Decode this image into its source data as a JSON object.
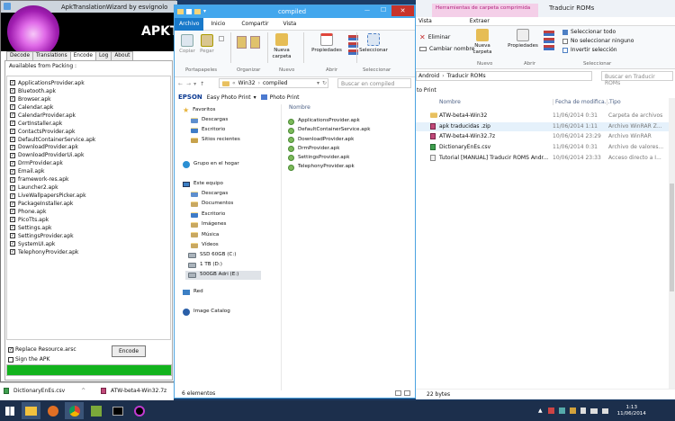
{
  "desktop": {
    "bg": "#1b3c67"
  },
  "apk_wizard": {
    "title": "ApkTranslationWizard by esvignolo",
    "logo_text": "APKT",
    "tabs": [
      "Decode",
      "Translations",
      "Encode",
      "Log",
      "About"
    ],
    "available_label": "Availables from Packing :",
    "files": [
      "ApplicationsProvider.apk",
      "Bluetooth.apk",
      "Browser.apk",
      "Calendar.apk",
      "CalendarProvider.apk",
      "CertInstaller.apk",
      "ContactsProvider.apk",
      "DefaultContainerService.apk",
      "DownloadProvider.apk",
      "DownloadProviderUi.apk",
      "DrmProvider.apk",
      "Email.apk",
      "framework-res.apk",
      "Launcher2.apk",
      "LiveWallpapersPicker.apk",
      "PackageInstaller.apk",
      "Phone.apk",
      "PicoTts.apk",
      "Settings.apk",
      "SettingsProvider.apk",
      "SystemUI.apk",
      "TelephonyProvider.apk"
    ],
    "check_mark": "✓",
    "replace_label": "Replace Resource.arsc",
    "sign_label": "Sign the APK",
    "encode_button": "Encode"
  },
  "explorer": {
    "title": "compiled",
    "quick_access": "▾",
    "min": "—",
    "max": "☐",
    "close": "✕",
    "ribbon_tabs": [
      "Archivo",
      "Inicio",
      "Compartir",
      "Vista"
    ],
    "groups": [
      "Portapapeles",
      "Organizar",
      "Nuevo",
      "Abrir",
      "Seleccionar"
    ],
    "btn_copiar": "Copiar",
    "btn_pegar": "Pegar",
    "btn_nueva": "Nueva carpeta",
    "btn_propiedades": "Propiedades",
    "btn_seleccionar": "Seleccionar",
    "nav_back": "←",
    "nav_fwd": "→",
    "nav_up": "↑",
    "path_prefix": "«",
    "path": [
      "Win32",
      "compiled"
    ],
    "path_sep": "›",
    "dropdown": "▾",
    "refresh": "↻",
    "search_placeholder": "Buscar en compiled",
    "epson": "EPSON",
    "epson_app": "Easy Photo Print",
    "epson_sep": "▾",
    "photo_print": "Photo Print",
    "nav_tree": {
      "favorites": "Favoritos",
      "fav_items": [
        "Descargas",
        "Escritorio",
        "Sitios recientes"
      ],
      "homegroup": "Grupo en el hogar",
      "this_pc": "Este equipo",
      "pc_items": [
        "Descargas",
        "Documentos",
        "Escritorio",
        "Imágenes",
        "Música",
        "Vídeos"
      ],
      "drives": [
        "SSD 60GB (C:)",
        "1 TB (D:)",
        "500GB Adri (E:)"
      ],
      "network": "Red",
      "image_catalog": "Image Catalog"
    },
    "col_name": "Nombre",
    "files": [
      "ApplicationsProvider.apk",
      "DefaultContainerService.apk",
      "DownloadProvider.apk",
      "DrmProvider.apk",
      "SettingsProvider.apk",
      "TelephonyProvider.apk"
    ],
    "status": "6 elementos"
  },
  "back_explorer": {
    "context_tab": "Herramientas de carpeta comprimida",
    "title": "Traducir ROMs",
    "ribbon_tabs": [
      "Vista",
      "Extraer"
    ],
    "btn_eliminar": "Eliminar",
    "btn_cambiar": "Cambiar nombre",
    "btn_nueva": "Nueva carpeta",
    "btn_propiedades": "Propiedades",
    "sel_all": "Seleccionar todo",
    "sel_none": "No seleccionar ninguno",
    "sel_invert": "Invertir selección",
    "groups": [
      "Nuevo",
      "Abrir",
      "Seleccionar"
    ],
    "path": [
      "Android",
      "Traducir ROMs"
    ],
    "search_placeholder": "Buscar en Traducir ROMs",
    "photo_print": "to Print",
    "cols": [
      "Nombre",
      "Fecha de modifica...",
      "Tipo"
    ],
    "rows": [
      {
        "name": "ATW-beta4-Win32",
        "date": "11/06/2014 0:31",
        "type": "Carpeta de archivos",
        "icon": "folder"
      },
      {
        "name": "apk traducidas .zip",
        "date": "11/06/2014 1:11",
        "type": "Archivo WinRAR Z...",
        "icon": "zip"
      },
      {
        "name": "ATW-beta4-Win32.7z",
        "date": "10/06/2014 23:29",
        "type": "Archivo WinRAR",
        "icon": "zip"
      },
      {
        "name": "DictionaryEnEs.csv",
        "date": "11/06/2014 0:31",
        "type": "Archivo de valores...",
        "icon": "csv"
      },
      {
        "name": "Tutorial [MANUAL] Traducir ROMS Andr...",
        "date": "10/06/2014 23:33",
        "type": "Acceso directo a I...",
        "icon": "lnk"
      }
    ],
    "status": "22 bytes"
  },
  "downloads_bar": {
    "items": [
      "DictionaryEnEs.csv",
      "ATW-beta4-Win32.7z"
    ],
    "caret": "^"
  },
  "taskbar": {
    "time": "1:13",
    "date": "11/06/2014",
    "arrow": "▲"
  }
}
